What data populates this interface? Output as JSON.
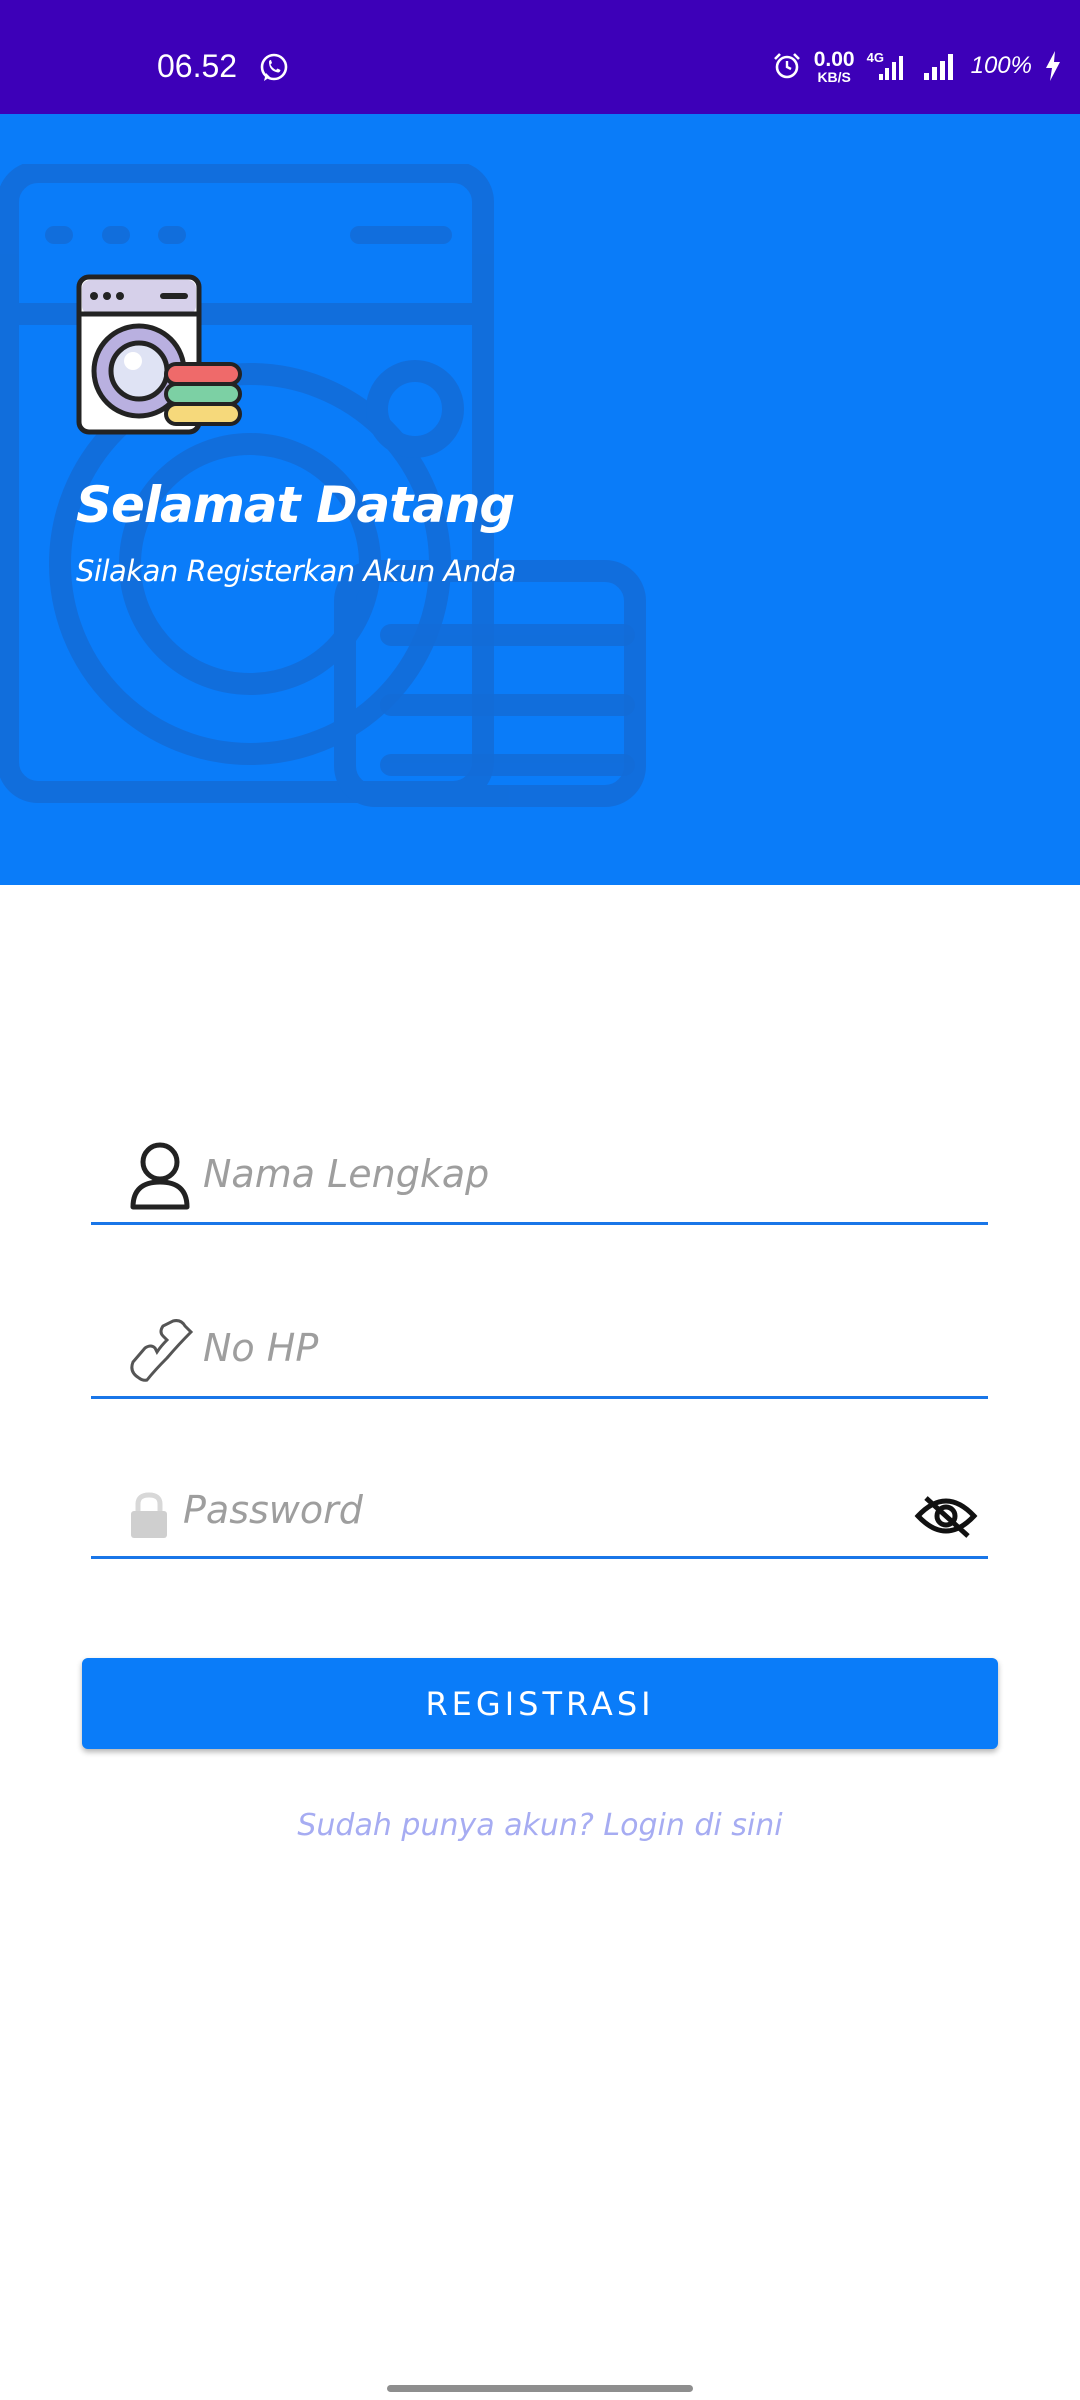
{
  "status_bar": {
    "time": "06.52",
    "net_speed_value": "0.00",
    "net_speed_unit": "KB/S",
    "network_type": "4G",
    "battery": "100%"
  },
  "header": {
    "title": "Selamat Datang",
    "subtitle": "Silakan Registerkan Akun Anda"
  },
  "form": {
    "name_placeholder": "Nama Lengkap",
    "phone_placeholder": "No HP",
    "password_placeholder": "Password"
  },
  "register_button": "REGISTRASI",
  "login_link": "Sudah punya akun? Login di sini",
  "colors": {
    "status_bar": "#3d00b8",
    "primary": "#0a7cf9",
    "link": "#a6acf2",
    "placeholder": "#9e9e9e"
  }
}
